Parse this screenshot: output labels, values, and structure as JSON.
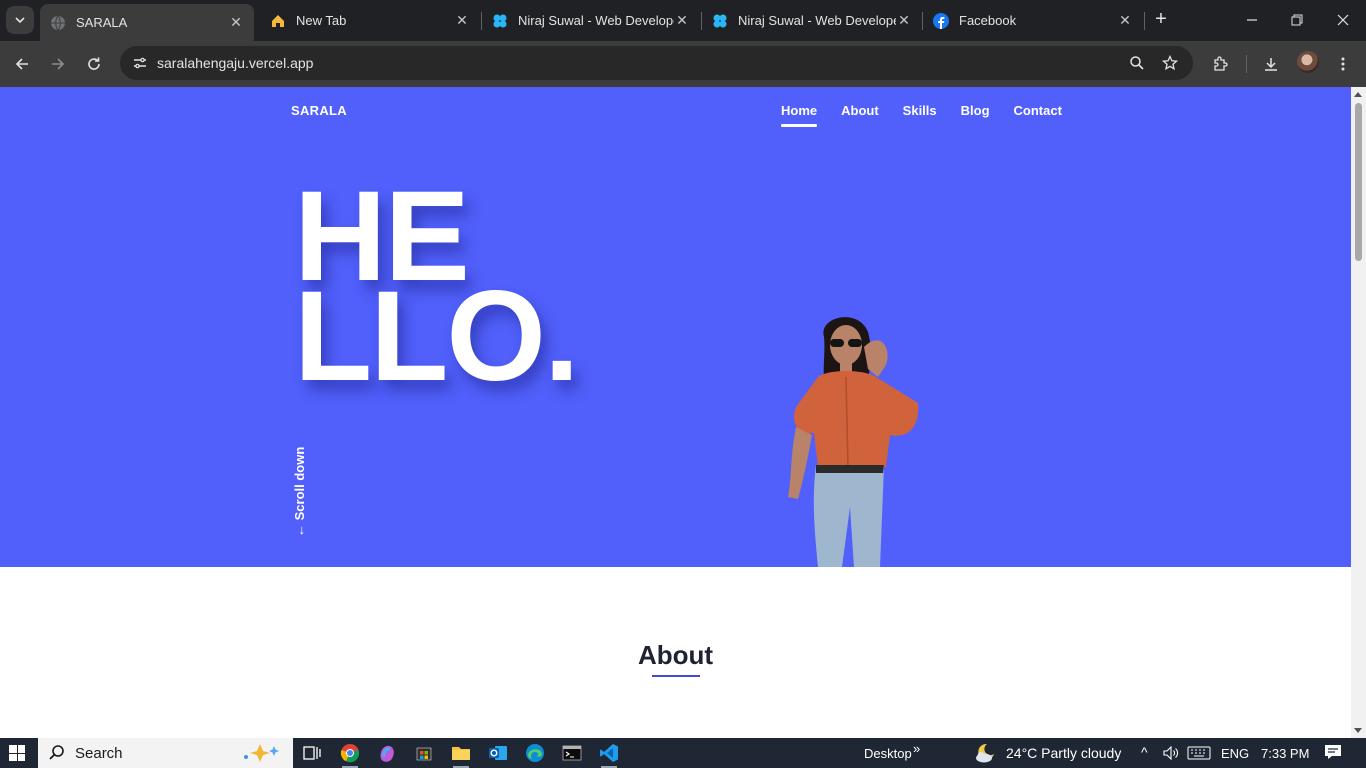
{
  "browser": {
    "tabs": [
      {
        "title": "SARALA",
        "favicon": "globe-icon",
        "active": true
      },
      {
        "title": "New Tab",
        "favicon": "home-icon",
        "active": false
      },
      {
        "title": "Niraj Suwal - Web Developer",
        "favicon": "clover-icon",
        "active": false
      },
      {
        "title": "Niraj Suwal - Web Developer",
        "favicon": "clover-icon",
        "active": false
      },
      {
        "title": "Facebook",
        "favicon": "facebook-icon",
        "active": false
      }
    ],
    "url": "saralahengaju.vercel.app"
  },
  "site": {
    "brand": "SARALA",
    "nav": [
      "Home",
      "About",
      "Skills",
      "Blog",
      "Contact"
    ],
    "active_nav": "Home",
    "hero_line1": "HE",
    "hero_line2": "LLO.",
    "scroll_hint": "← Scroll down",
    "about_heading": "About",
    "colors": {
      "hero_bg": "#5160fb",
      "heading": "#1e2233",
      "accent": "#3f4bd0"
    }
  },
  "taskbar": {
    "search_label": "Search",
    "desktop_label": "Desktop",
    "weather": "24°C  Partly cloudy",
    "language": "ENG",
    "time": "7:33 PM"
  }
}
